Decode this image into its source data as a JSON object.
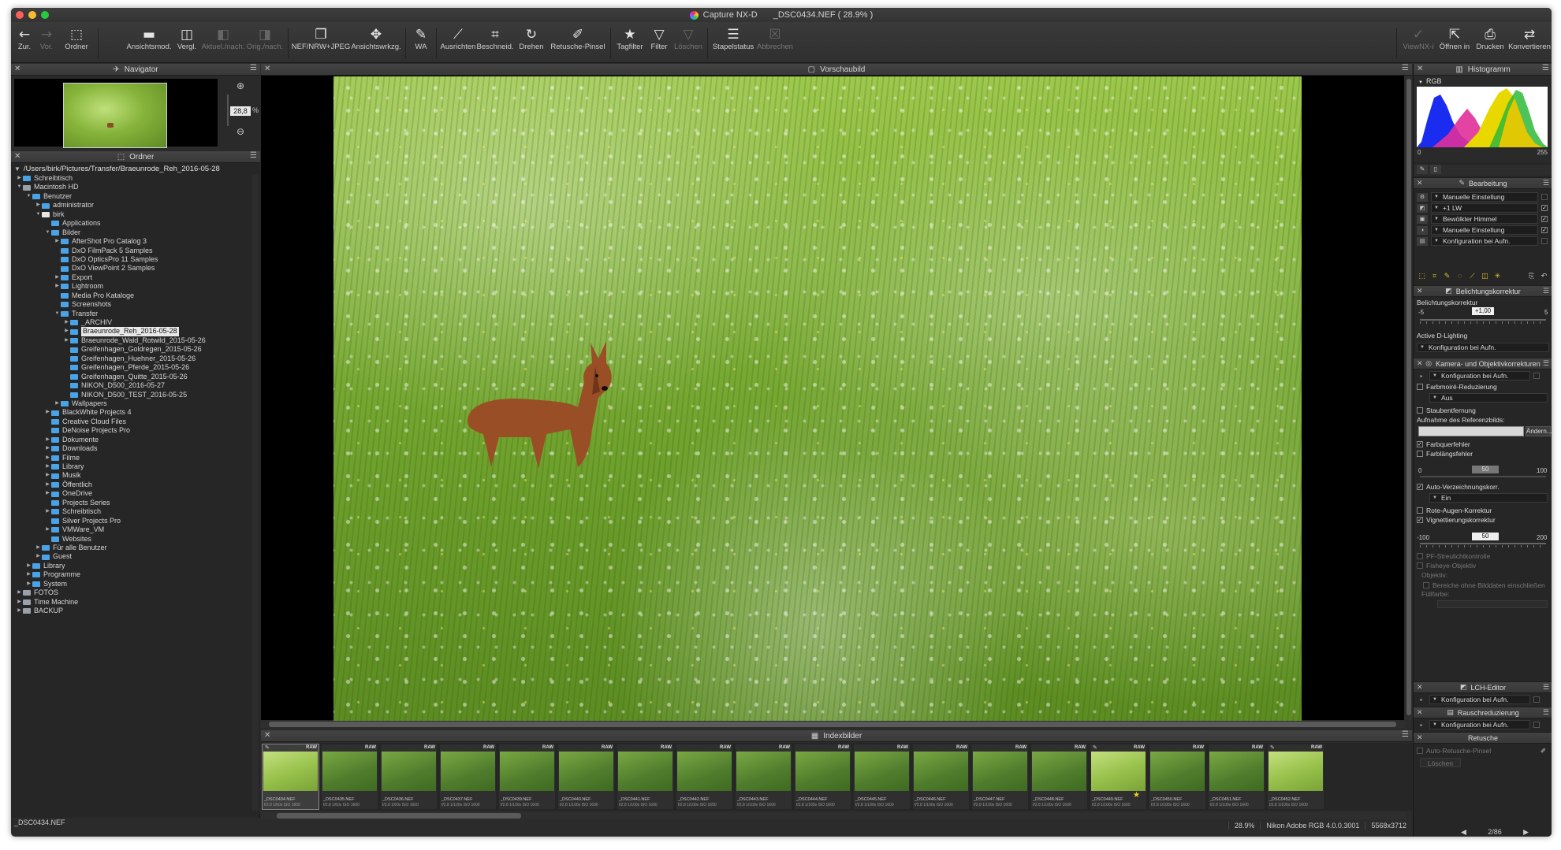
{
  "window": {
    "app_title": "Capture NX-D",
    "file_title": "_DSC0434.NEF ( 28.9% )"
  },
  "toolbar": {
    "left": [
      {
        "label": "Zur.",
        "icon": "arrow-left-icon",
        "glyph": "←",
        "disabled": false
      },
      {
        "label": "Vor.",
        "icon": "arrow-right-icon",
        "glyph": "→",
        "disabled": true
      },
      {
        "label": "Ordner",
        "icon": "folder-icon",
        "glyph": "⬚",
        "disabled": false
      }
    ],
    "middle": [
      {
        "label": "Ansichtsmod.",
        "icon": "view-mode-icon",
        "glyph": "▬",
        "disabled": false
      },
      {
        "label": "Vergl.",
        "icon": "compare-icon",
        "glyph": "◫",
        "disabled": false
      },
      {
        "label": "Aktuel./nach.",
        "icon": "before-after-icon",
        "glyph": "◧",
        "disabled": true
      },
      {
        "label": "Orig./nach.",
        "icon": "original-after-icon",
        "glyph": "◨",
        "disabled": true
      },
      {
        "label": "NEF/NRW+JPEG",
        "icon": "nef-jpeg-icon",
        "glyph": "❐",
        "disabled": false
      },
      {
        "label": "Ansichtswrkzg.",
        "icon": "view-tools-icon",
        "glyph": "✥",
        "disabled": false
      },
      {
        "label": "WA",
        "icon": "white-balance-icon",
        "glyph": "✎",
        "disabled": false
      },
      {
        "label": "Ausrichten",
        "icon": "straighten-icon",
        "glyph": "⟋",
        "disabled": false
      },
      {
        "label": "Beschneid.",
        "icon": "crop-icon",
        "glyph": "⌗",
        "disabled": false
      },
      {
        "label": "Drehen",
        "icon": "rotate-icon",
        "glyph": "↻",
        "disabled": false
      },
      {
        "label": "Retusche-Pinsel",
        "icon": "retouch-brush-icon",
        "glyph": "✐",
        "disabled": false
      },
      {
        "label": "Tagfilter",
        "icon": "star-filter-icon",
        "glyph": "★",
        "disabled": false
      },
      {
        "label": "Filter",
        "icon": "filter-icon",
        "glyph": "▽",
        "disabled": false
      },
      {
        "label": "Löschen",
        "icon": "clear-filter-icon",
        "glyph": "▽",
        "disabled": true
      },
      {
        "label": "Stapelstatus",
        "icon": "batch-status-icon",
        "glyph": "☰",
        "disabled": false
      },
      {
        "label": "Abbrechen",
        "icon": "cancel-batch-icon",
        "glyph": "☒",
        "disabled": true
      }
    ],
    "right": [
      {
        "label": "ViewNX-i",
        "icon": "viewnx-icon",
        "glyph": "✓",
        "disabled": true
      },
      {
        "label": "Öffnen in",
        "icon": "open-in-icon",
        "glyph": "⇱",
        "disabled": false
      },
      {
        "label": "Drucken",
        "icon": "print-icon",
        "glyph": "⎙",
        "disabled": false
      },
      {
        "label": "Konvertieren",
        "icon": "convert-icon",
        "glyph": "⇄",
        "disabled": false
      }
    ]
  },
  "navigator": {
    "title": "Navigator",
    "zoom_value": "28,8",
    "zoom_unit": "%"
  },
  "folders": {
    "title": "Ordner",
    "path": "/Users/birk/Pictures/Transfer/Braeunrode_Reh_2016-05-28",
    "tree": [
      {
        "label": "Schreibtisch",
        "depth": 0,
        "toggle": "▶",
        "kind": "folder"
      },
      {
        "label": "Macintosh HD",
        "depth": 0,
        "toggle": "▼",
        "kind": "drive"
      },
      {
        "label": "Benutzer",
        "depth": 1,
        "toggle": "▼",
        "kind": "folder"
      },
      {
        "label": "administrator",
        "depth": 2,
        "toggle": "▶",
        "kind": "folder"
      },
      {
        "label": "birk",
        "depth": 2,
        "toggle": "▼",
        "kind": "home"
      },
      {
        "label": "Applications",
        "depth": 3,
        "toggle": "",
        "kind": "folder"
      },
      {
        "label": "Bilder",
        "depth": 3,
        "toggle": "▼",
        "kind": "folder"
      },
      {
        "label": "AfterShot Pro Catalog 3",
        "depth": 4,
        "toggle": "▶",
        "kind": "folder"
      },
      {
        "label": "DxO FilmPack 5 Samples",
        "depth": 4,
        "toggle": "",
        "kind": "folder"
      },
      {
        "label": "DxO OpticsPro 11 Samples",
        "depth": 4,
        "toggle": "",
        "kind": "folder"
      },
      {
        "label": "DxO ViewPoint 2 Samples",
        "depth": 4,
        "toggle": "",
        "kind": "folder"
      },
      {
        "label": "Export",
        "depth": 4,
        "toggle": "▶",
        "kind": "folder"
      },
      {
        "label": "Lightroom",
        "depth": 4,
        "toggle": "▶",
        "kind": "folder"
      },
      {
        "label": "Media Pro Kataloge",
        "depth": 4,
        "toggle": "",
        "kind": "folder"
      },
      {
        "label": "Screenshots",
        "depth": 4,
        "toggle": "",
        "kind": "folder"
      },
      {
        "label": "Transfer",
        "depth": 4,
        "toggle": "▼",
        "kind": "folder"
      },
      {
        "label": "_ARCHIV",
        "depth": 5,
        "toggle": "▶",
        "kind": "folder"
      },
      {
        "label": "Braeunrode_Reh_2016-05-28",
        "depth": 5,
        "toggle": "▶",
        "kind": "folder",
        "selected": true
      },
      {
        "label": "Braeunrode_Wald_Rotwild_2015-05-26",
        "depth": 5,
        "toggle": "▶",
        "kind": "folder"
      },
      {
        "label": "Greifenhagen_Goldregen_2015-05-26",
        "depth": 5,
        "toggle": "",
        "kind": "folder"
      },
      {
        "label": "Greifenhagen_Huehner_2015-05-26",
        "depth": 5,
        "toggle": "",
        "kind": "folder"
      },
      {
        "label": "Greifenhagen_Pferde_2015-05-26",
        "depth": 5,
        "toggle": "",
        "kind": "folder"
      },
      {
        "label": "Greifenhagen_Quitte_2015-05-26",
        "depth": 5,
        "toggle": "",
        "kind": "folder"
      },
      {
        "label": "NIKON_D500_2016-05-27",
        "depth": 5,
        "toggle": "",
        "kind": "folder"
      },
      {
        "label": "NIKON_D500_TEST_2016-05-25",
        "depth": 5,
        "toggle": "",
        "kind": "folder"
      },
      {
        "label": "Wallpapers",
        "depth": 4,
        "toggle": "▶",
        "kind": "folder"
      },
      {
        "label": "BlackWhite Projects 4",
        "depth": 3,
        "toggle": "▶",
        "kind": "folder"
      },
      {
        "label": "Creative Cloud Files",
        "depth": 3,
        "toggle": "",
        "kind": "folder"
      },
      {
        "label": "DeNoise Projects Pro",
        "depth": 3,
        "toggle": "",
        "kind": "folder"
      },
      {
        "label": "Dokumente",
        "depth": 3,
        "toggle": "▶",
        "kind": "folder"
      },
      {
        "label": "Downloads",
        "depth": 3,
        "toggle": "▶",
        "kind": "folder"
      },
      {
        "label": "Filme",
        "depth": 3,
        "toggle": "▶",
        "kind": "folder"
      },
      {
        "label": "Library",
        "depth": 3,
        "toggle": "▶",
        "kind": "folder"
      },
      {
        "label": "Musik",
        "depth": 3,
        "toggle": "▶",
        "kind": "folder"
      },
      {
        "label": "Öffentlich",
        "depth": 3,
        "toggle": "▶",
        "kind": "folder"
      },
      {
        "label": "OneDrive",
        "depth": 3,
        "toggle": "▶",
        "kind": "folder"
      },
      {
        "label": "Projects Series",
        "depth": 3,
        "toggle": "",
        "kind": "folder"
      },
      {
        "label": "Schreibtisch",
        "depth": 3,
        "toggle": "▶",
        "kind": "folder"
      },
      {
        "label": "Silver Projects Pro",
        "depth": 3,
        "toggle": "",
        "kind": "folder"
      },
      {
        "label": "VMWare_VM",
        "depth": 3,
        "toggle": "▶",
        "kind": "folder"
      },
      {
        "label": "Websites",
        "depth": 3,
        "toggle": "",
        "kind": "folder"
      },
      {
        "label": "Für alle Benutzer",
        "depth": 2,
        "toggle": "▶",
        "kind": "folder"
      },
      {
        "label": "Guest",
        "depth": 2,
        "toggle": "▶",
        "kind": "folder"
      },
      {
        "label": "Library",
        "depth": 1,
        "toggle": "▶",
        "kind": "folder"
      },
      {
        "label": "Programme",
        "depth": 1,
        "toggle": "▶",
        "kind": "folder"
      },
      {
        "label": "System",
        "depth": 1,
        "toggle": "▶",
        "kind": "folder"
      },
      {
        "label": "FOTOS",
        "depth": 0,
        "toggle": "▶",
        "kind": "drive"
      },
      {
        "label": "Time Machine",
        "depth": 0,
        "toggle": "▶",
        "kind": "drive"
      },
      {
        "label": "BACKUP",
        "depth": 0,
        "toggle": "▶",
        "kind": "drive"
      }
    ]
  },
  "left_status": "_DSC0434.NEF",
  "preview": {
    "title": "Vorschaubild"
  },
  "filmstrip": {
    "title": "Indexbilder",
    "raw_badge": "RAW",
    "items": [
      {
        "name": "_DSC0434.NEF",
        "meta": "f/2.8 1/60s ISO 1600",
        "selected": true,
        "edited": true,
        "bright": true
      },
      {
        "name": "_DSC0435.NEF",
        "meta": "f/2.8 1/60s ISO 1600"
      },
      {
        "name": "_DSC0436.NEF",
        "meta": "f/2.8 1/60s ISO 1600"
      },
      {
        "name": "_DSC0437.NEF",
        "meta": "f/2.8 1/100s ISO 1600"
      },
      {
        "name": "_DSC0439.NEF",
        "meta": "f/2.8 1/100s ISO 1600"
      },
      {
        "name": "_DSC0440.NEF",
        "meta": "f/2.8 1/100s ISO 1600"
      },
      {
        "name": "_DSC0441.NEF",
        "meta": "f/2.8 1/100s ISO 1600"
      },
      {
        "name": "_DSC0442.NEF",
        "meta": "f/2.8 1/100s ISO 1600"
      },
      {
        "name": "_DSC0443.NEF",
        "meta": "f/2.8 1/100s ISO 1600"
      },
      {
        "name": "_DSC0444.NEF",
        "meta": "f/2.8 1/100s ISO 1600"
      },
      {
        "name": "_DSC0445.NEF",
        "meta": "f/2.8 1/100s ISO 1600"
      },
      {
        "name": "_DSC0446.NEF",
        "meta": "f/2.8 1/100s ISO 1600"
      },
      {
        "name": "_DSC0447.NEF",
        "meta": "f/2.8 1/100s ISO 1600"
      },
      {
        "name": "_DSC0448.NEF",
        "meta": "f/2.8 1/100s ISO 1600"
      },
      {
        "name": "_DSC0449.NEF",
        "meta": "f/2.8 1/100s ISO 1600",
        "edited": true,
        "bright": true,
        "star": true
      },
      {
        "name": "_DSC0450.NEF",
        "meta": "f/2.8 1/100s ISO 1600"
      },
      {
        "name": "_DSC0451.NEF",
        "meta": "f/2.8 1/100s ISO 1600"
      },
      {
        "name": "_DSC0452.NEF",
        "meta": "f/2.8 1/100s ISO 1600",
        "edited": true,
        "bright": true
      }
    ]
  },
  "status_bar": {
    "zoom": "28.9%",
    "profile": "Nikon Adobe RGB 4.0.0.3001",
    "dimensions": "5568x3712"
  },
  "histogram": {
    "title": "Histogramm",
    "channel": "RGB",
    "min_label": "0",
    "max_label": "255"
  },
  "bearbeitung": {
    "title": "Bearbeitung",
    "rows": [
      {
        "icon": "gear-icon",
        "label": "Manuelle Einstellung",
        "checked": false
      },
      {
        "icon": "wb-icon",
        "label": "+1 LW",
        "checked": true
      },
      {
        "icon": "picture-control-icon",
        "label": "Bewölkter Himmel",
        "checked": true
      },
      {
        "icon": "tone-icon",
        "label": "Manuelle Einstellung",
        "checked": true
      },
      {
        "icon": "camera-settings-icon",
        "label": "Konfiguration bei Aufn.",
        "checked": false
      }
    ]
  },
  "belichtung": {
    "title": "Belichtungskorrektur",
    "label": "Belichtungskorrektur",
    "min": "-5",
    "max": "5",
    "value": "+1,00",
    "adl_label": "Active D-Lighting",
    "adl_value": "Konfiguration bei Aufn."
  },
  "kamera": {
    "title": "Kamera- und Objektivkorrekturen",
    "config_value": "Konfiguration bei Aufn.",
    "farbmoire_label": "Farbmoiré-Reduzierung",
    "farbmoire_value": "Aus",
    "staub_label": "Staubentfernung",
    "referenz_label": "Aufnahme des Referenzbilds:",
    "aendern_label": "Ändern...",
    "farbquer_label": "Farbquerfehler",
    "farblaengs_label": "Farblängsfehler",
    "farblaengs_min": "0",
    "farblaengs_value": "50",
    "farblaengs_max": "100",
    "verzeichnung_label": "Auto-Verzeichnungskorr.",
    "verzeichnung_value": "Ein",
    "rote_augen_label": "Rote-Augen-Korrektur",
    "vignette_label": "Vignettierungskorrektur",
    "vignette_min": "-100",
    "vignette_value": "50",
    "vignette_max": "200",
    "pf_label": "PF-Streulichtkontrolle",
    "fisheye_label": "Fisheye-Objektiv",
    "objektiv_label": "Objektiv:",
    "bereiche_label": "Bereiche ohne Bilddaten einschließen",
    "fuellfarbe_label": "Füllfarbe:"
  },
  "lch": {
    "title": "LCH-Editor",
    "value": "Konfiguration bei Aufn."
  },
  "rausch": {
    "title": "Rauschreduzierung",
    "value": "Konfiguration bei Aufn."
  },
  "retusche": {
    "title": "Retusche",
    "auto_label": "Auto-Retusche-Pinsel",
    "loeschen_label": "Löschen"
  },
  "right_status": {
    "page": "2/86"
  }
}
